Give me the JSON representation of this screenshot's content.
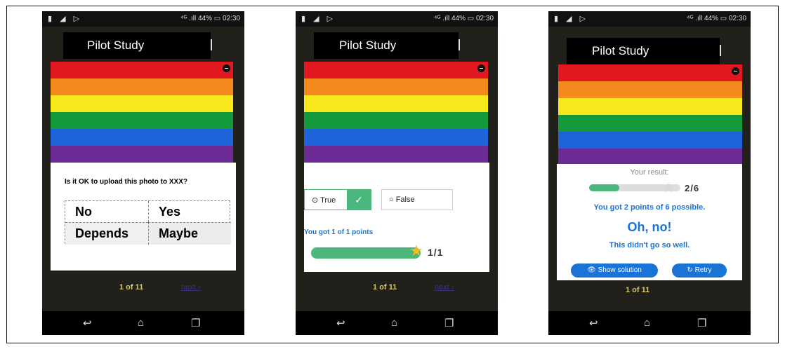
{
  "status": {
    "left_icons": "▮ ◢ ▷",
    "right": "⁴ᴳ .ıll 44% ▭ 02:30"
  },
  "app": {
    "title": "Pilot Study"
  },
  "screen1": {
    "question": "Is it OK to upload this photo to XXX?",
    "options": [
      "No",
      "Yes",
      "Depends",
      "Maybe"
    ],
    "pager": {
      "count": "1 of 11",
      "next": "next ›"
    }
  },
  "screen2": {
    "true_label": "True",
    "false_label": "False",
    "score_text": "You got 1 of 1 points",
    "progress": 1.0,
    "fraction": "1/1",
    "pager": {
      "count": "1 of 11",
      "next": "next ›"
    }
  },
  "screen3": {
    "result_label": "Your result:",
    "progress": 0.333,
    "fraction": "2/6",
    "points_text": "You got 2 points of 6 possible.",
    "headline": "Oh, no!",
    "subline": "This didn't go so well.",
    "show_solution": "Show solution",
    "retry": "Retry",
    "pager": {
      "count": "1 of 11"
    }
  },
  "nav": {
    "back": "↩",
    "home": "⌂",
    "recent": "❐"
  },
  "colors": {
    "accent_blue": "#1a73d6",
    "success_green": "#4ab77d",
    "star": "#f2bc1c"
  }
}
